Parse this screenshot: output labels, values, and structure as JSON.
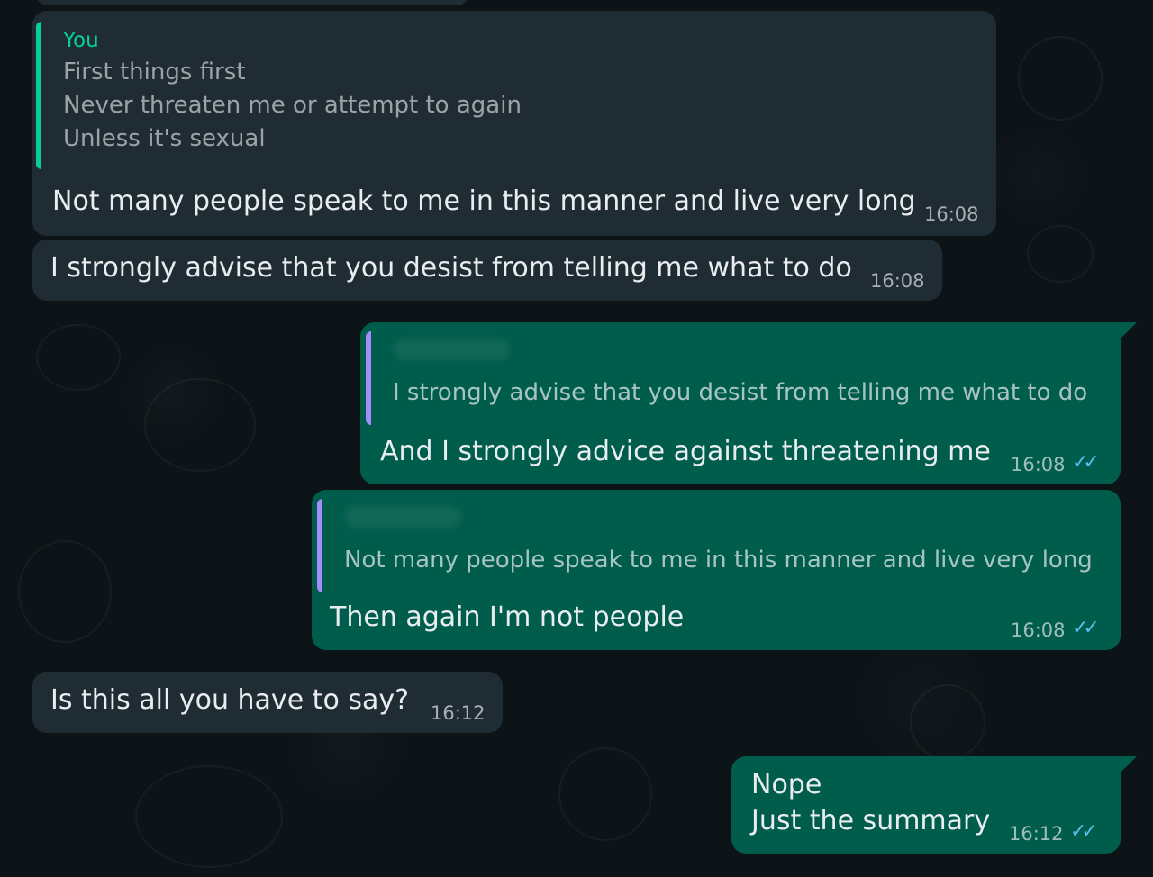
{
  "messages": [
    {
      "direction": "incoming",
      "quote": {
        "author": "You",
        "lines": [
          "First things first",
          "Never threaten me or attempt to again",
          "Unless it's sexual"
        ]
      },
      "text": "Not many people speak to me in this manner and live very long",
      "time": "16:08"
    },
    {
      "direction": "incoming",
      "text": "I strongly advise that you desist from telling me what to do",
      "time": "16:08"
    },
    {
      "direction": "outgoing",
      "quote": {
        "lines": [
          "I strongly advise that you desist from telling me what to do"
        ]
      },
      "text": "And I strongly advice against threatening me",
      "time": "16:08",
      "status": "read"
    },
    {
      "direction": "outgoing",
      "quote": {
        "lines": [
          "Not many people speak to me in this manner and live very long"
        ]
      },
      "text": "Then again I'm not people",
      "time": "16:08",
      "status": "read"
    },
    {
      "direction": "incoming",
      "text": "Is this all you have to say?",
      "time": "16:12"
    },
    {
      "direction": "outgoing",
      "lines": [
        "Nope",
        "Just the summary"
      ],
      "time": "16:12",
      "status": "read"
    }
  ],
  "icons": {
    "read_receipt": "double-check-icon"
  },
  "colors": {
    "background": "#0d1418",
    "incoming_bubble": "#202c33",
    "outgoing_bubble": "#005c4b",
    "quote_bar_incoming": "#06cf9c",
    "quote_bar_outgoing": "#a78bfa",
    "read_tick": "#53bdeb"
  }
}
